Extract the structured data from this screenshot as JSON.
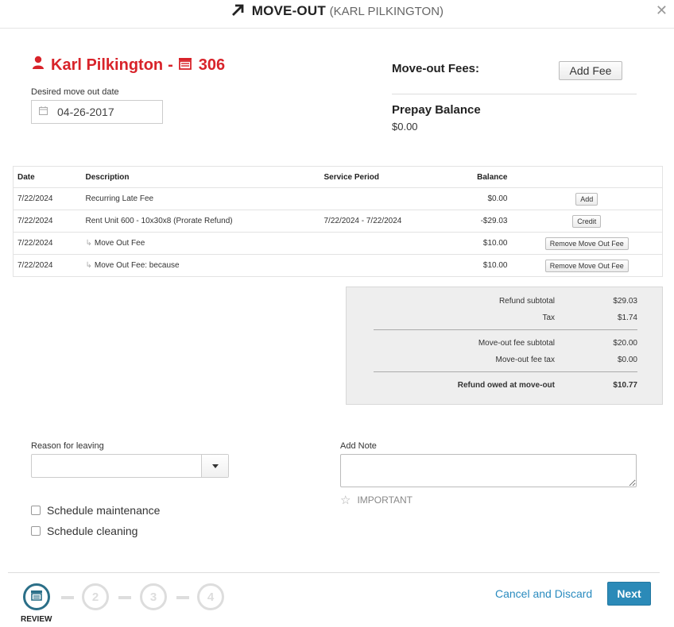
{
  "header": {
    "title": "MOVE-OUT",
    "subtitle": "(KARL PILKINGTON)"
  },
  "tenant": {
    "name": "Karl Pilkington",
    "separator": "-",
    "unit": "306",
    "color": "#d8232a"
  },
  "move_out_date": {
    "label": "Desired move out date",
    "value": "04-26-2017"
  },
  "fees": {
    "label": "Move-out Fees:",
    "add_button": "Add Fee"
  },
  "prepay": {
    "label": "Prepay Balance",
    "value": "$0.00"
  },
  "ledger": {
    "columns": [
      "Date",
      "Description",
      "Service Period",
      "Balance"
    ],
    "rows": [
      {
        "date": "7/22/2024",
        "description": "Recurring Late Fee",
        "period": "",
        "balance": "$0.00",
        "action": "Add"
      },
      {
        "date": "7/22/2024",
        "description": "Rent Unit 600 - 10x30x8 (Prorate Refund)",
        "period": "7/22/2024 - 7/22/2024",
        "balance": "-$29.03",
        "action": "Credit"
      },
      {
        "date": "7/22/2024",
        "description": "Move Out Fee",
        "period": "",
        "balance": "$10.00",
        "action": "Remove Move Out Fee"
      },
      {
        "date": "7/22/2024",
        "description": "Move Out Fee: because",
        "period": "",
        "balance": "$10.00",
        "action": "Remove Move Out Fee"
      }
    ]
  },
  "summary": {
    "refund_subtotal_label": "Refund subtotal",
    "refund_subtotal": "$29.03",
    "tax_label": "Tax",
    "tax": "$1.74",
    "fee_subtotal_label": "Move-out fee subtotal",
    "fee_subtotal": "$20.00",
    "fee_tax_label": "Move-out fee tax",
    "fee_tax": "$0.00",
    "refund_owed_label": "Refund owed at move-out",
    "refund_owed": "$10.77"
  },
  "reason": {
    "label": "Reason for leaving",
    "value": ""
  },
  "schedule_maintenance": {
    "label": "Schedule maintenance",
    "checked": false
  },
  "schedule_cleaning": {
    "label": "Schedule cleaning",
    "checked": false
  },
  "note": {
    "label": "Add Note",
    "value": "",
    "important_label": "IMPORTANT"
  },
  "steps": {
    "items": [
      "2",
      "3",
      "4"
    ],
    "active_label": "REVIEW",
    "active_color": "#2b6f88"
  },
  "footer": {
    "cancel_label": "Cancel and Discard",
    "next_label": "Next",
    "accent": "#2b8ab8"
  }
}
